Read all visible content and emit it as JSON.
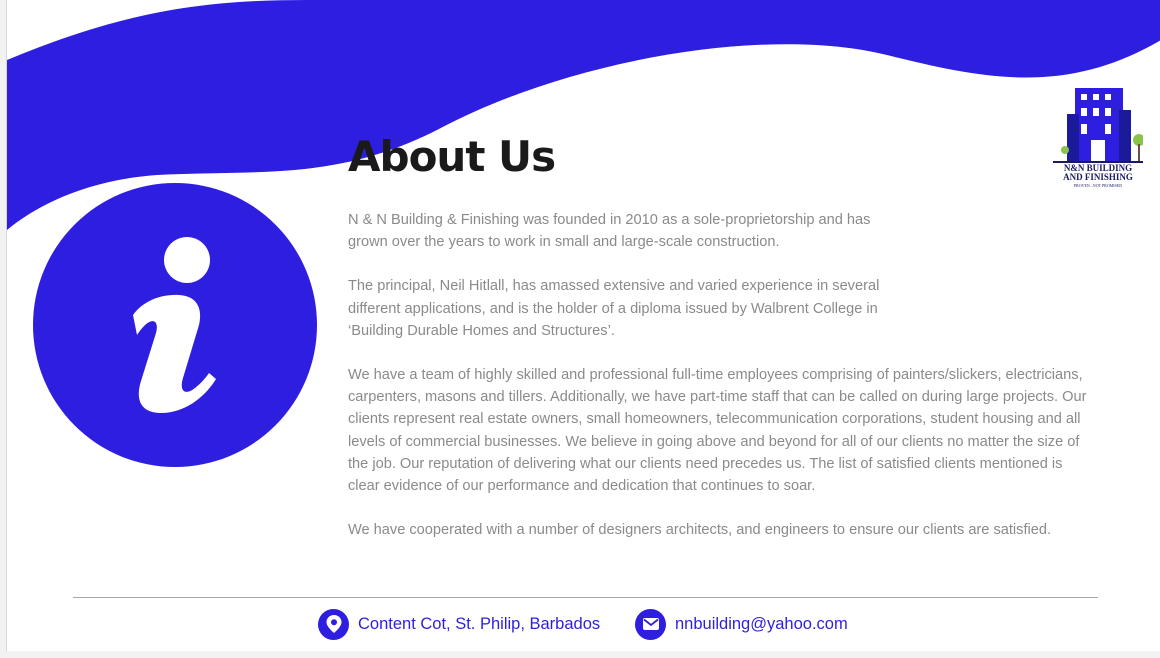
{
  "title": "About Us",
  "paragraphs": [
    "N & N Building & Finishing was founded in 2010 as a sole-proprietorship and has grown over the years to work in small and large-scale construction.",
    "The principal, Neil Hitlall, has amassed extensive and varied experience in several different applications, and is the holder of a diploma issued by Walbrent College in ‘Building Durable Homes and Structures’.",
    "We have a team of highly skilled and professional full-time employees comprising of painters/slickers, electricians, carpenters, masons and tillers. Additionally, we have part-time staff that can be called on during large projects. Our clients represent real estate owners, small homeowners, telecommunication corporations, student housing and all levels of commercial businesses. We believe in going above and beyond for all of our clients no matter the size of the job. Our reputation of delivering what our clients need precedes us. The list of satisfied clients mentioned is clear evidence of our performance and dedication that continues to soar.",
    "We have cooperated with a number of designers architects, and engineers to ensure our clients are satisfied."
  ],
  "logo": {
    "line1": "N&N BUILDING",
    "line2": "AND FINISHING",
    "tagline": "PROVEN...NOT PROMISED"
  },
  "footer": {
    "address": "Content Cot, St. Philip, Barbados",
    "email": "nnbuilding@yahoo.com"
  },
  "icons": {
    "info": "info-icon",
    "location": "location-pin-icon",
    "email": "envelope-icon"
  },
  "colors": {
    "accent": "#2e1fe0",
    "title": "#1a1a1a",
    "body_text": "#8a8a8a"
  }
}
